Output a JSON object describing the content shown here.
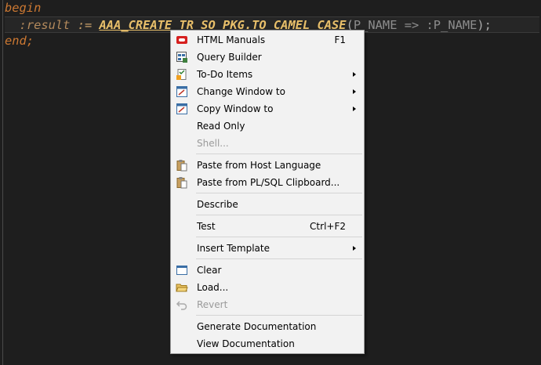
{
  "editor": {
    "line1": {
      "keyword": "begin"
    },
    "line2": {
      "bind_var": ":result",
      "assign": ":=",
      "call": "AAA_CREATE_TR_SO_PKG.TO_CAMEL_CASE",
      "open_paren": "(",
      "args": "P_NAME => :P_NAME",
      "close": ");"
    },
    "line3": {
      "keyword": "end;"
    }
  },
  "context_menu": {
    "items": [
      {
        "label": "HTML Manuals",
        "shortcut": "F1",
        "icon": "oracle-icon"
      },
      {
        "label": "Query Builder",
        "icon": "query-builder-icon"
      },
      {
        "label": "To-Do Items",
        "icon": "todo-icon",
        "submenu": true
      },
      {
        "label": "Change Window to",
        "icon": "window-icon",
        "submenu": true
      },
      {
        "label": "Copy Window to",
        "icon": "window-icon",
        "submenu": true
      },
      {
        "label": "Read Only"
      },
      {
        "label": "Shell...",
        "disabled": true
      },
      {
        "label": "Paste from Host Language",
        "icon": "paste-icon"
      },
      {
        "label": "Paste from PL/SQL Clipboard...",
        "icon": "paste-icon"
      },
      {
        "label": "Describe"
      },
      {
        "label": "Test",
        "shortcut": "Ctrl+F2"
      },
      {
        "label": "Insert Template",
        "submenu": true
      },
      {
        "label": "Clear",
        "icon": "clear-window-icon"
      },
      {
        "label": "Load...",
        "icon": "open-folder-icon"
      },
      {
        "label": "Revert",
        "icon": "undo-icon",
        "disabled": true
      },
      {
        "label": "Generate Documentation"
      },
      {
        "label": "View Documentation"
      }
    ]
  },
  "colors": {
    "editor_bg": "#1e1e1e",
    "keyword": "#cc7832",
    "package_call": "#e8bf6a",
    "menu_bg": "#f2f2f2",
    "disabled_text": "#9a9a9a"
  }
}
